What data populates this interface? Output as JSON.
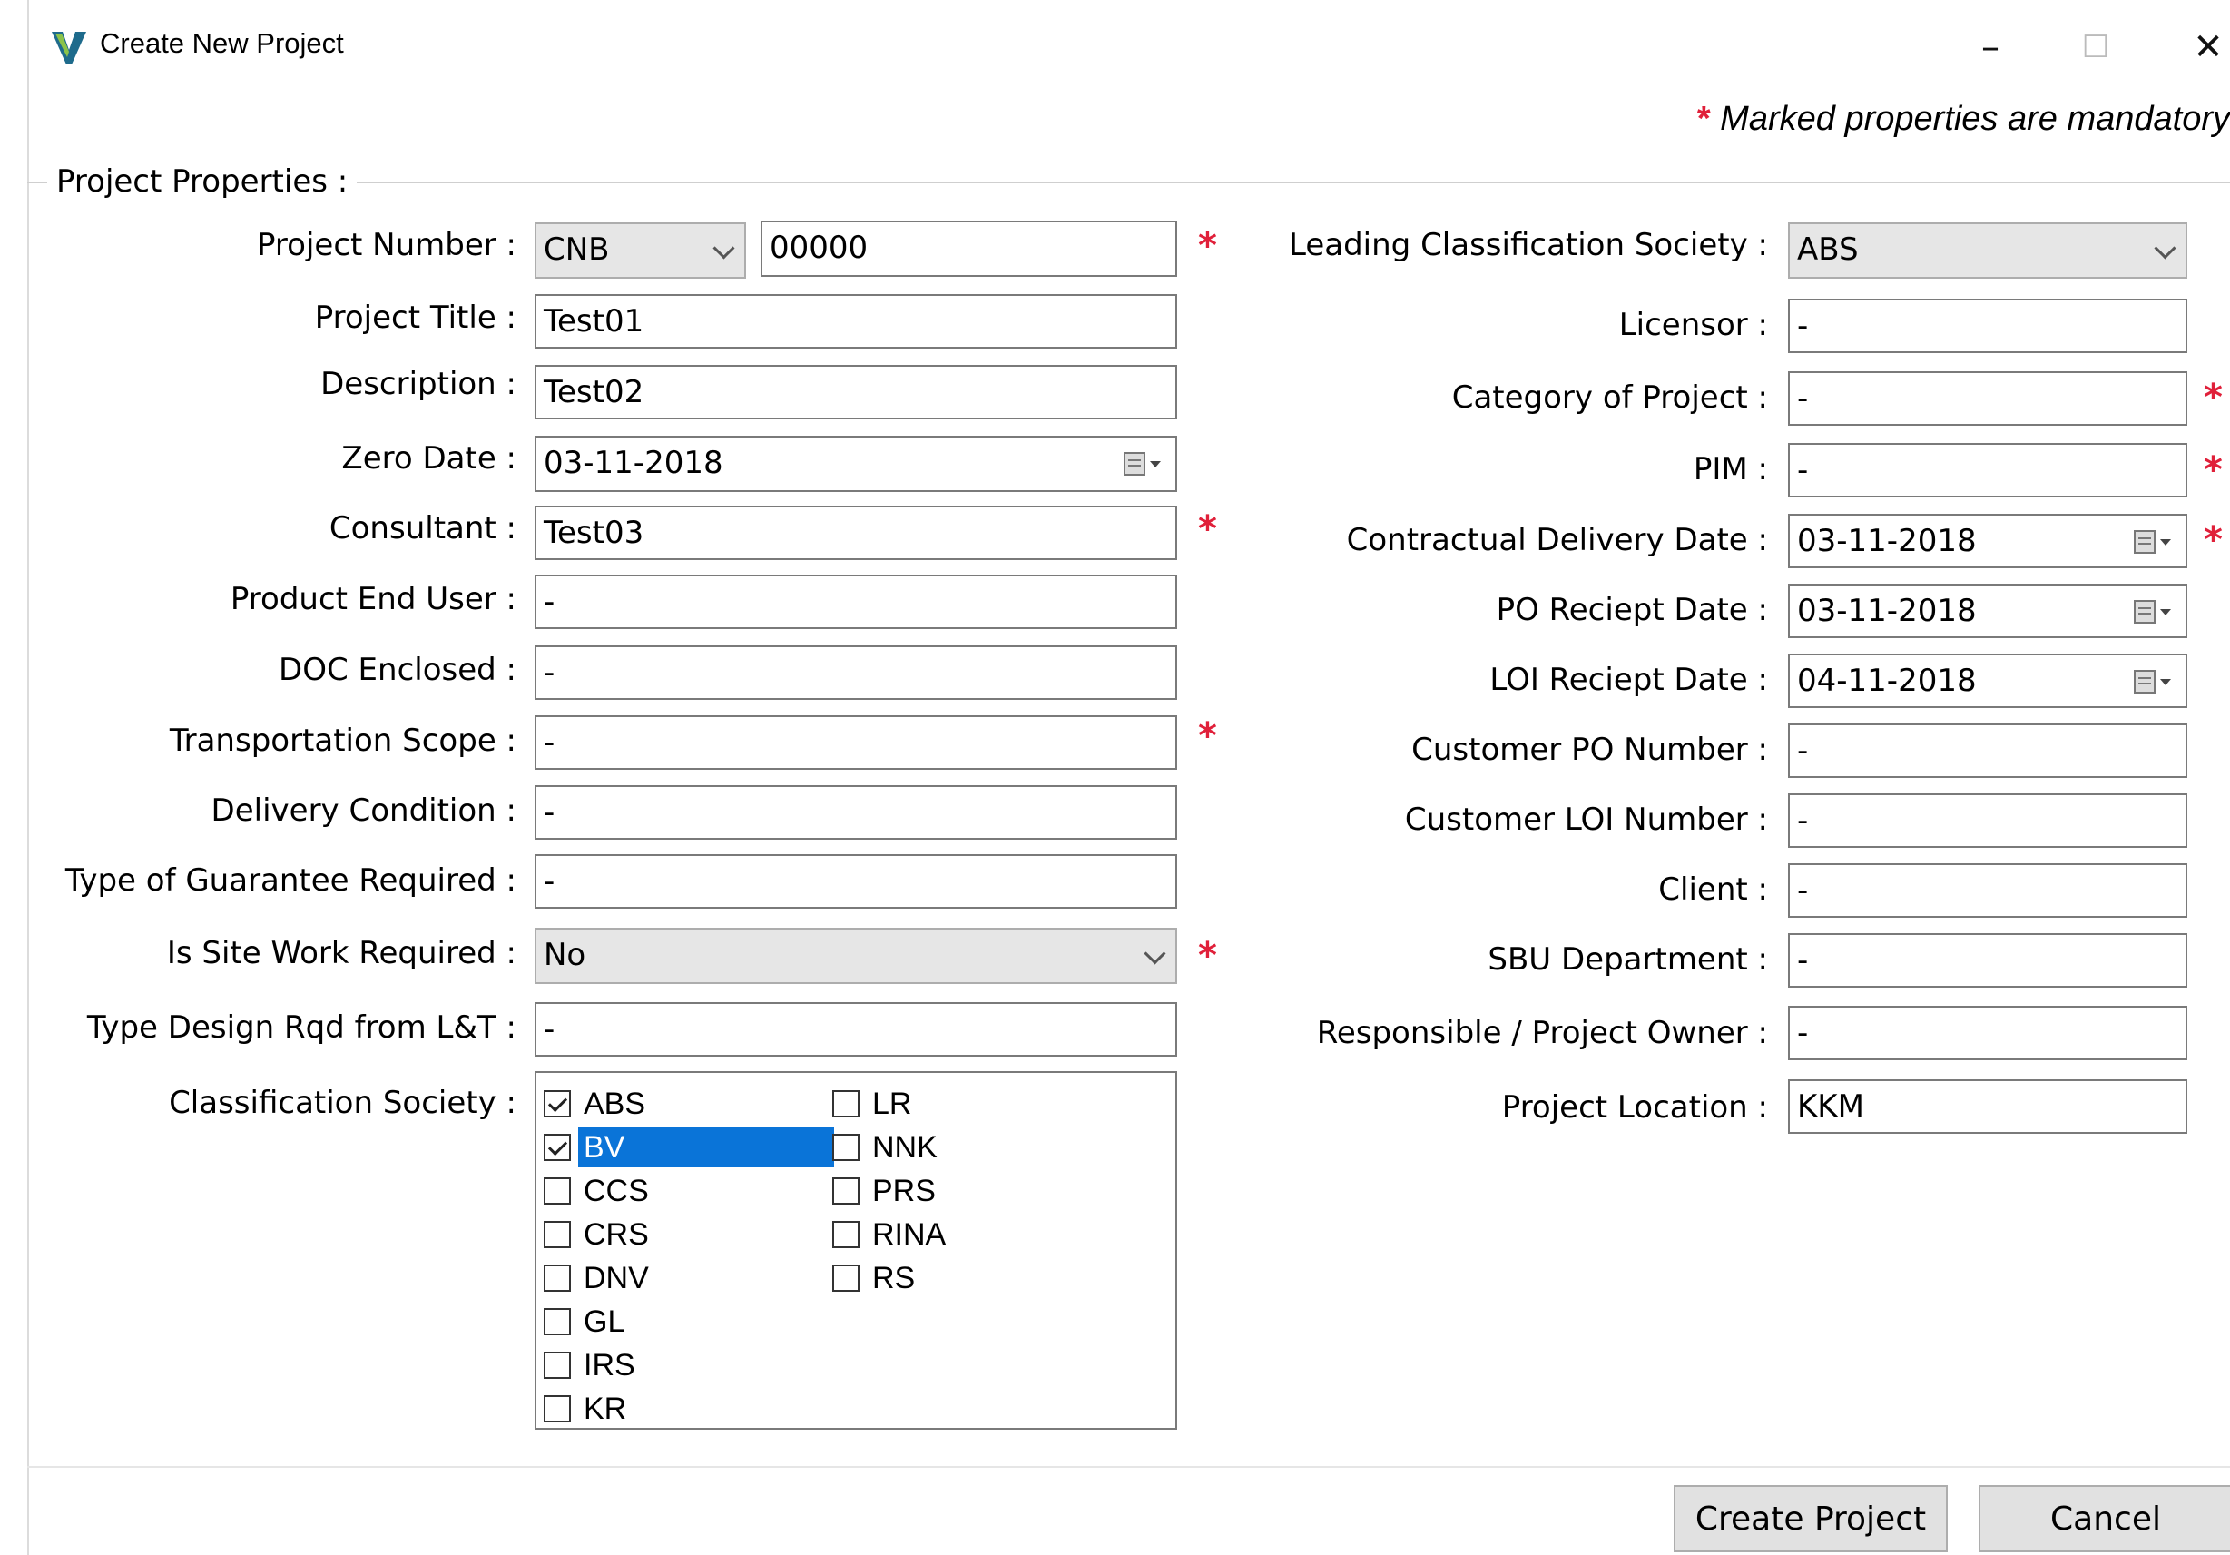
{
  "window": {
    "title": "Create New Project",
    "minimize_glyph": "–",
    "maximize_glyph": "☐",
    "close_glyph": "✕"
  },
  "notice": {
    "marker": "*",
    "text": "Marked properties are mandatory"
  },
  "group": {
    "label": "Project Properties :"
  },
  "colors": {
    "required": "#e0203a",
    "selection": "#0a74d8"
  },
  "left_fields": {
    "project_number": {
      "label": "Project Number :",
      "prefix": "CNB",
      "value": "00000"
    },
    "project_title": {
      "label": "Project Title :",
      "value": "Test01"
    },
    "description": {
      "label": "Description :",
      "value": "Test02"
    },
    "zero_date": {
      "label": "Zero Date :",
      "value": "03-11-2018"
    },
    "consultant": {
      "label": "Consultant :",
      "value": "Test03"
    },
    "product_end_user": {
      "label": "Product End User :",
      "value": "-"
    },
    "doc_enclosed": {
      "label": "DOC Enclosed :",
      "value": "-"
    },
    "transportation_scope": {
      "label": "Transportation Scope :",
      "value": "-"
    },
    "delivery_condition": {
      "label": "Delivery Condition :",
      "value": "-"
    },
    "type_of_guarantee": {
      "label": "Type of Guarantee Required :",
      "value": "-"
    },
    "is_site_work_required": {
      "label": "Is Site Work Required :",
      "value": "No"
    },
    "type_design_rqd": {
      "label": "Type Design Rqd from L&T :",
      "value": "-"
    },
    "classification_society": {
      "label": "Classification Society :"
    }
  },
  "classification_options": [
    {
      "label": "ABS",
      "checked": true
    },
    {
      "label": "BV",
      "checked": true,
      "selected": true
    },
    {
      "label": "CCS",
      "checked": false
    },
    {
      "label": "CRS",
      "checked": false
    },
    {
      "label": "DNV",
      "checked": false
    },
    {
      "label": "GL",
      "checked": false
    },
    {
      "label": "IRS",
      "checked": false
    },
    {
      "label": "KR",
      "checked": false
    },
    {
      "label": "LR",
      "checked": false
    },
    {
      "label": "NNK",
      "checked": false
    },
    {
      "label": "PRS",
      "checked": false
    },
    {
      "label": "RINA",
      "checked": false
    },
    {
      "label": "RS",
      "checked": false
    }
  ],
  "right_fields": {
    "leading_classification_society": {
      "label": "Leading Classification Society :",
      "value": "ABS"
    },
    "licensor": {
      "label": "Licensor :",
      "value": "-"
    },
    "category_of_project": {
      "label": "Category of Project :",
      "value": "-"
    },
    "pim": {
      "label": "PIM :",
      "value": "-"
    },
    "contractual_delivery_date": {
      "label": "Contractual Delivery Date :",
      "value": "03-11-2018"
    },
    "po_receipt_date": {
      "label": "PO Reciept Date :",
      "value": "03-11-2018"
    },
    "loi_receipt_date": {
      "label": "LOI Reciept Date :",
      "value": "04-11-2018"
    },
    "customer_po_number": {
      "label": "Customer PO Number :",
      "value": "-"
    },
    "customer_loi_number": {
      "label": "Customer LOI Number :",
      "value": "-"
    },
    "client": {
      "label": "Client :",
      "value": "-"
    },
    "sbu_department": {
      "label": "SBU Department :",
      "value": "-"
    },
    "responsible_owner": {
      "label": "Responsible / Project Owner :",
      "value": "-"
    },
    "project_location": {
      "label": "Project Location :",
      "value": "KKM"
    }
  },
  "buttons": {
    "create": "Create Project",
    "cancel": "Cancel"
  }
}
